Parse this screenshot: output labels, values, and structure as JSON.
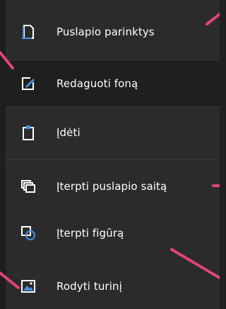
{
  "menu": {
    "items": [
      {
        "label": "Puslapio parinktys",
        "icon": "page-options-icon"
      },
      {
        "label": "Redaguoti foną",
        "icon": "edit-background-icon"
      },
      {
        "label": "Įdėti",
        "icon": "paste-icon"
      },
      {
        "label": "Įterpti puslapio saitą",
        "icon": "insert-page-link-icon"
      },
      {
        "label": "Įterpti figūrą",
        "icon": "insert-shape-icon"
      },
      {
        "label": "Rodyti turinį",
        "icon": "show-content-icon"
      }
    ]
  },
  "colors": {
    "accent": "#e0447a",
    "icon_blue": "#4a8fe0",
    "menu_bg": "#2b2b2b",
    "active_bg": "#1f1f1f",
    "text": "#ffffff"
  }
}
